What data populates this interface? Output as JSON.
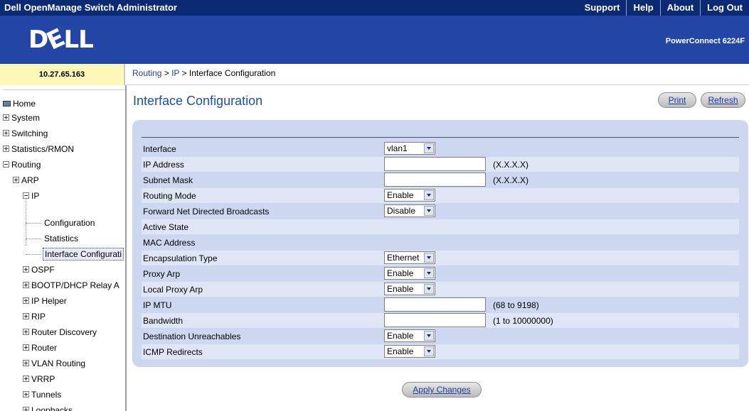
{
  "app": {
    "title": "Dell OpenManage Switch Administrator",
    "top_links": [
      "Support",
      "Help",
      "About",
      "Log Out"
    ],
    "logo_text": [
      "D",
      "E",
      "LL"
    ],
    "model": "PowerConnect 6224F"
  },
  "ip_address": "10.27.65.163",
  "breadcrumb": {
    "routing": "Routing",
    "sep1": " > ",
    "ip": "IP",
    "sep2": " > ",
    "current": "Interface Configuration"
  },
  "sidebar": {
    "home": "Home",
    "items": {
      "system": "System",
      "switching": "Switching",
      "statistics": "Statistics/RMON",
      "routing": "Routing",
      "arp": "ARP",
      "ip": "IP",
      "configuration": "Configuration",
      "statistics_sub": "Statistics",
      "interface_config": "Interface Configurati",
      "ospf": "OSPF",
      "bootp": "BOOTP/DHCP Relay A",
      "ip_helper": "IP Helper",
      "rip": "RIP",
      "router_discovery": "Router Discovery",
      "router": "Router",
      "vlan_routing": "VLAN Routing",
      "vrrp": "VRRP",
      "tunnels": "Tunnels",
      "loopbacks": "Loopbacks"
    }
  },
  "page": {
    "title": "Interface Configuration",
    "print_label": "Print",
    "refresh_label": "Refresh",
    "apply_label": "Apply Changes"
  },
  "form": {
    "interface": {
      "label": "Interface",
      "value": "vlan1"
    },
    "ip_address": {
      "label": "IP Address",
      "value": "",
      "hint": "(X.X.X.X)"
    },
    "subnet_mask": {
      "label": "Subnet Mask",
      "value": "",
      "hint": "(X.X.X.X)"
    },
    "routing_mode": {
      "label": "Routing Mode",
      "value": "Enable"
    },
    "forward_broadcasts": {
      "label": "Forward Net Directed Broadcasts",
      "value": "Disable"
    },
    "active_state": {
      "label": "Active State"
    },
    "mac_address": {
      "label": "MAC Address"
    },
    "encapsulation": {
      "label": "Encapsulation Type",
      "value": "Ethernet"
    },
    "proxy_arp": {
      "label": "Proxy Arp",
      "value": "Enable"
    },
    "local_proxy_arp": {
      "label": "Local Proxy Arp",
      "value": "Enable"
    },
    "ip_mtu": {
      "label": "IP MTU",
      "value": "",
      "hint": "(68 to 9198)"
    },
    "bandwidth": {
      "label": "Bandwidth",
      "value": "",
      "hint": "(1 to 10000000)"
    },
    "dest_unreachables": {
      "label": "Destination Unreachables",
      "value": "Enable"
    },
    "icmp_redirects": {
      "label": "ICMP Redirects",
      "value": "Enable"
    }
  },
  "colors": {
    "topbar": "#0b2a73",
    "banner": "#2346a6",
    "panel": "#cdd7ef",
    "title": "#1d4fa8",
    "ipbox": "#fdf7b8"
  }
}
